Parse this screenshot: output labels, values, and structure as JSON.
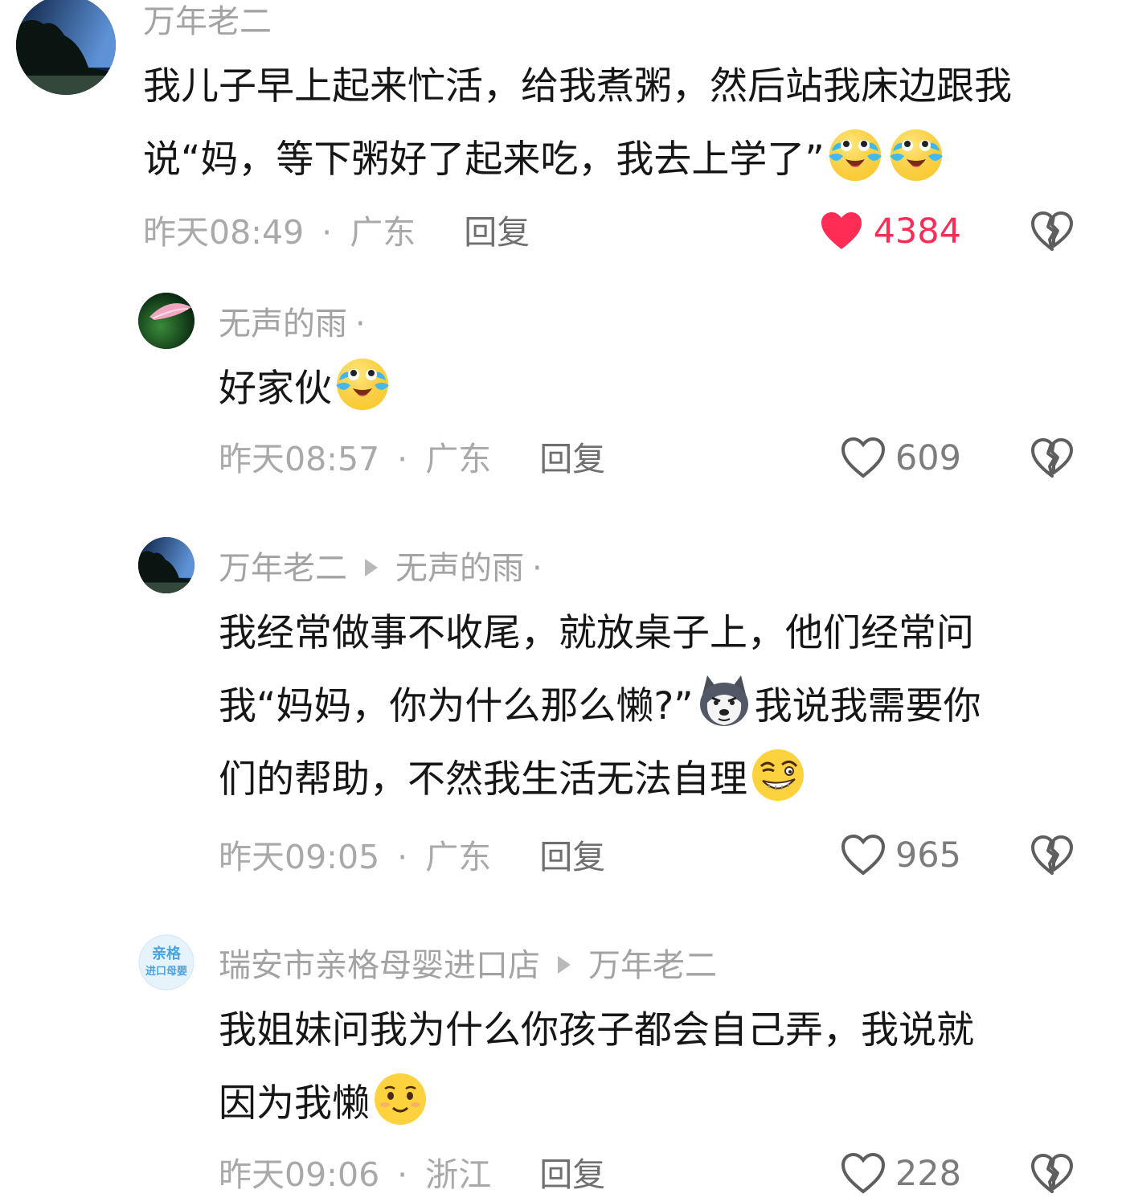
{
  "comments": [
    {
      "author": "万年老二",
      "reply_to": "",
      "lines": [
        {
          "text": "我儿子早上起来忙活，给我煮粥，然后站我床边跟我",
          "emojis": []
        },
        {
          "text": "说“妈，等下粥好了起来吃，我去上学了”",
          "emojis": [
            "crying-laughing-emoji",
            "crying-laughing-emoji"
          ]
        }
      ],
      "time": "昨天08:49",
      "location": "广东",
      "reply_label": "回复",
      "likes": "4384",
      "liked": true
    },
    {
      "author": "无声的雨",
      "reply_to": "",
      "lines": [
        {
          "text": "好家伙",
          "emojis": [
            "crying-laughing-emoji"
          ]
        }
      ],
      "time": "昨天08:57",
      "location": "广东",
      "reply_label": "回复",
      "likes": "609",
      "liked": false
    },
    {
      "author": "万年老二",
      "reply_to": "无声的雨",
      "lines": [
        {
          "text": "我经常做事不收尾，就放桌子上，他们经常问",
          "emojis": []
        },
        {
          "text": "我“妈妈，你为什么那么懒?”",
          "emojis": [
            "husky-dog-emoji"
          ],
          "after": "我说我需要你"
        },
        {
          "text": "们的帮助，不然我生活无法自理",
          "emojis": [
            "smirk-emoji"
          ]
        }
      ],
      "time": "昨天09:05",
      "location": "广东",
      "reply_label": "回复",
      "likes": "965",
      "liked": false
    },
    {
      "author": "瑞安市亲格母婴进口店",
      "reply_to": "万年老二",
      "avatar_text": [
        "亲格",
        "进口母婴"
      ],
      "lines": [
        {
          "text": "我姐妹问我为什么你孩子都会自己弄，我说就",
          "emojis": []
        },
        {
          "text": "因为我懒",
          "emojis": [
            "shy-smile-emoji"
          ]
        }
      ],
      "time": "昨天09:06",
      "location": "浙江",
      "reply_label": "回复",
      "likes": "228",
      "liked": false
    }
  ],
  "colors": {
    "like_active": "#ff2c55",
    "meta_gray": "#a9a9a9"
  }
}
